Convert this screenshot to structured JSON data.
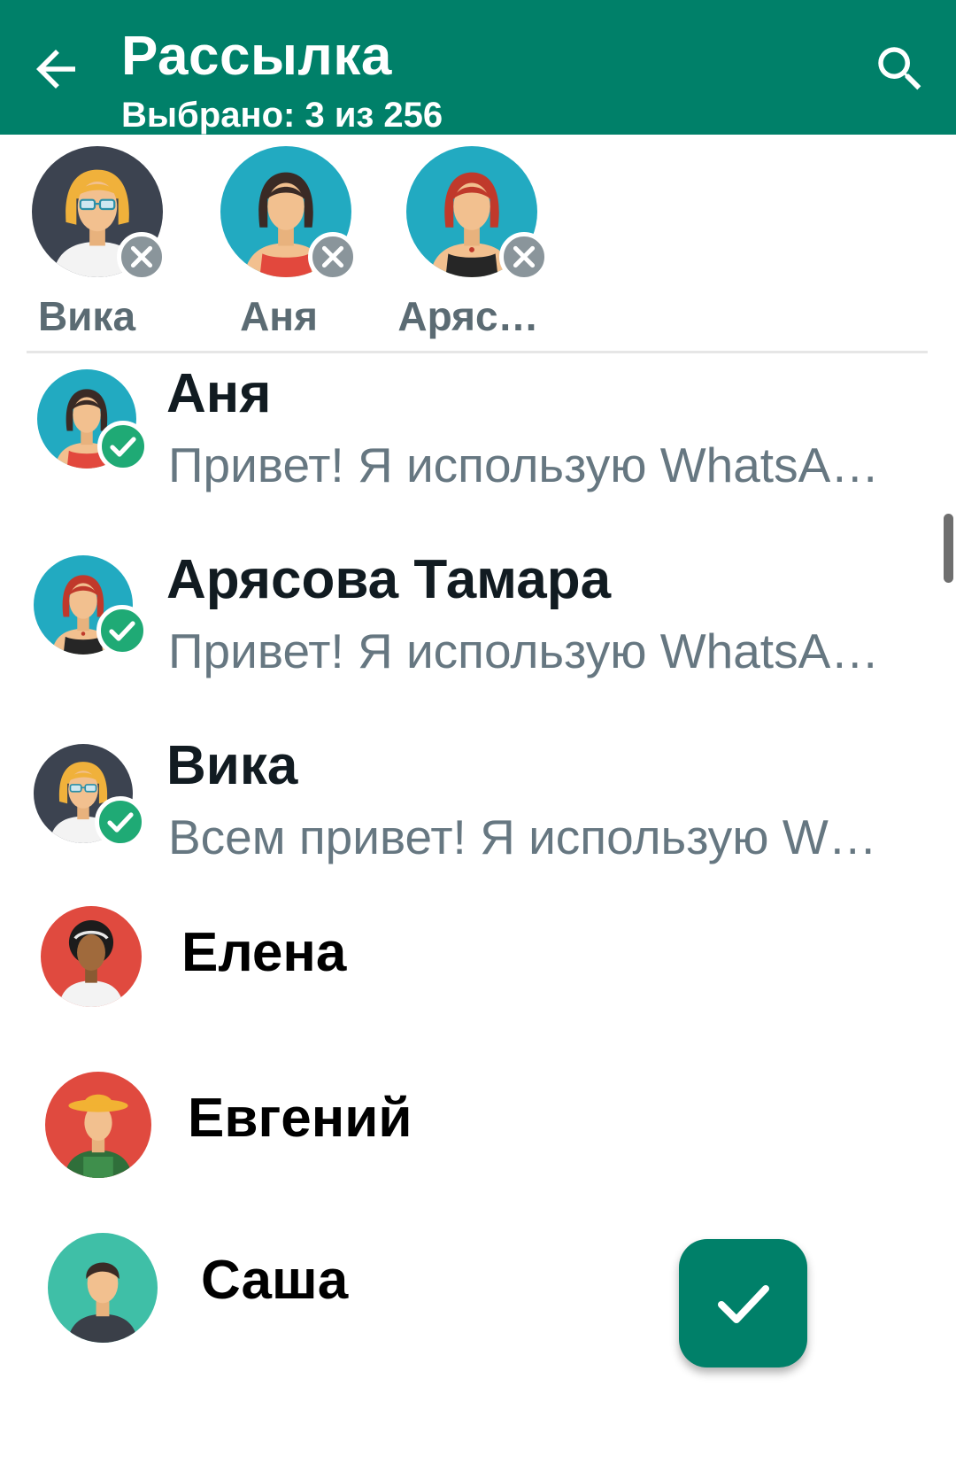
{
  "colors": {
    "accent": "#008069",
    "check": "#1faa75",
    "remove": "#8a959b"
  },
  "header": {
    "back_icon": "arrow-left-icon",
    "title": "Рассылка",
    "subtitle": "Выбрано: 3 из 256",
    "search_icon": "search-icon"
  },
  "selected": [
    {
      "name": "Вика",
      "avatar": "woman-glasses-avatar"
    },
    {
      "name": "Аня",
      "avatar": "woman-red-dress-avatar"
    },
    {
      "name": "Аряс…",
      "avatar": "woman-redhead-avatar"
    }
  ],
  "contacts": [
    {
      "name": "Аня",
      "status": "Привет! Я использую WhatsA…",
      "selected": true
    },
    {
      "name": "Арясова Тамара",
      "status": "Привет! Я использую WhatsA…",
      "selected": true
    },
    {
      "name": "Вика",
      "status": "Всем привет! Я использую W…",
      "selected": true
    },
    {
      "name": "Елена",
      "status": "",
      "selected": false
    },
    {
      "name": "Евгений",
      "status": "",
      "selected": false
    },
    {
      "name": "Саша",
      "status": "",
      "selected": false
    }
  ],
  "fab": {
    "icon": "checkmark-icon"
  }
}
